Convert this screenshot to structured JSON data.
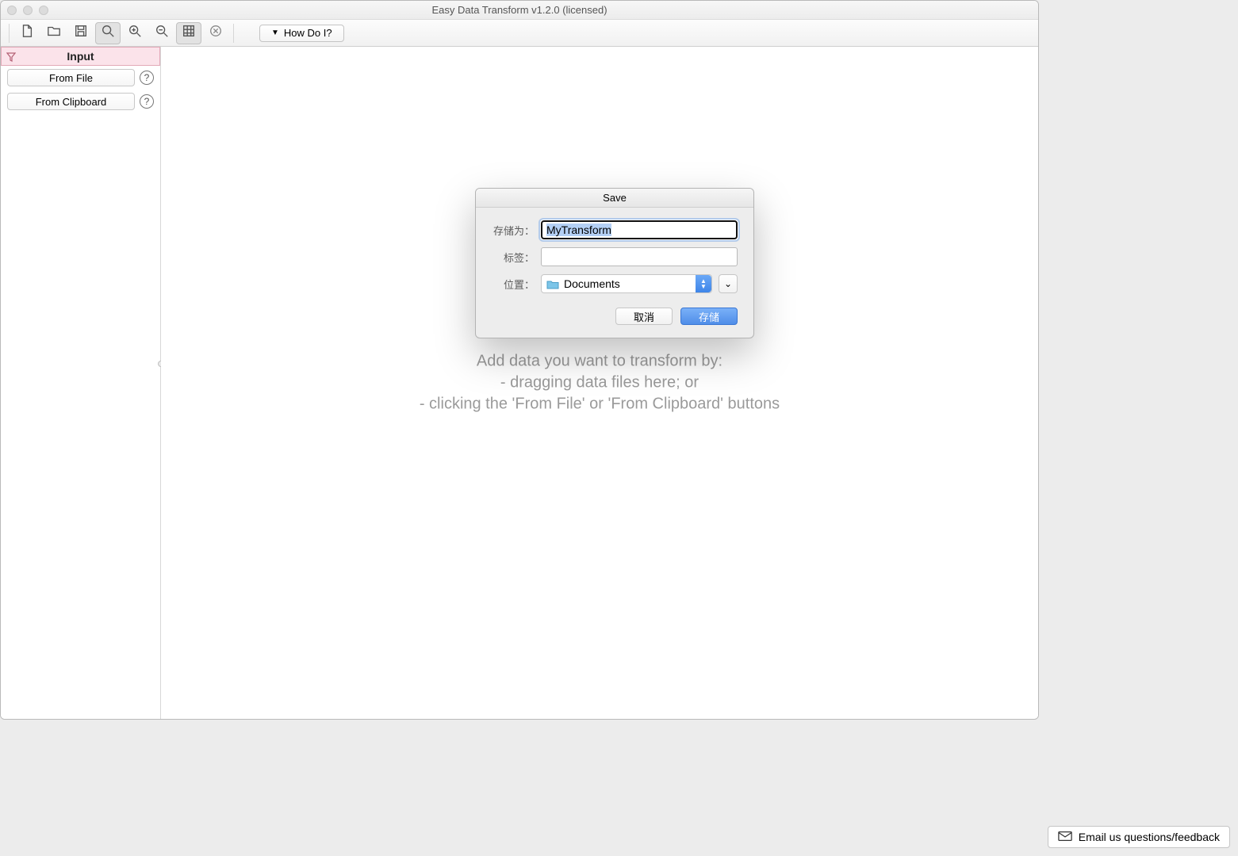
{
  "window": {
    "title": "Easy Data Transform v1.2.0 (licensed)"
  },
  "toolbar": {
    "how_do_i": "How Do I?"
  },
  "sidebar": {
    "title": "Input",
    "from_file": "From File",
    "from_clipboard": "From Clipboard"
  },
  "canvas": {
    "placeholder_line1": "Add data you want to transform by:",
    "placeholder_line2": "- dragging data files here; or",
    "placeholder_line3": "- clicking the 'From File' or 'From Clipboard' buttons"
  },
  "save_dialog": {
    "title": "Save",
    "save_as_label": "存储为：",
    "save_as_value": "MyTransform",
    "tags_label": "标签：",
    "tags_value": "",
    "location_label": "位置：",
    "location_value": "Documents",
    "cancel": "取消",
    "save": "存储"
  },
  "feedback": {
    "label": "Email us questions/feedback"
  },
  "icons": {
    "new_file": "new-file",
    "open": "open",
    "save": "save",
    "zoom_fit": "zoom-fit",
    "zoom_in": "zoom-in",
    "zoom_out": "zoom-out",
    "grid": "grid",
    "delete": "delete"
  }
}
